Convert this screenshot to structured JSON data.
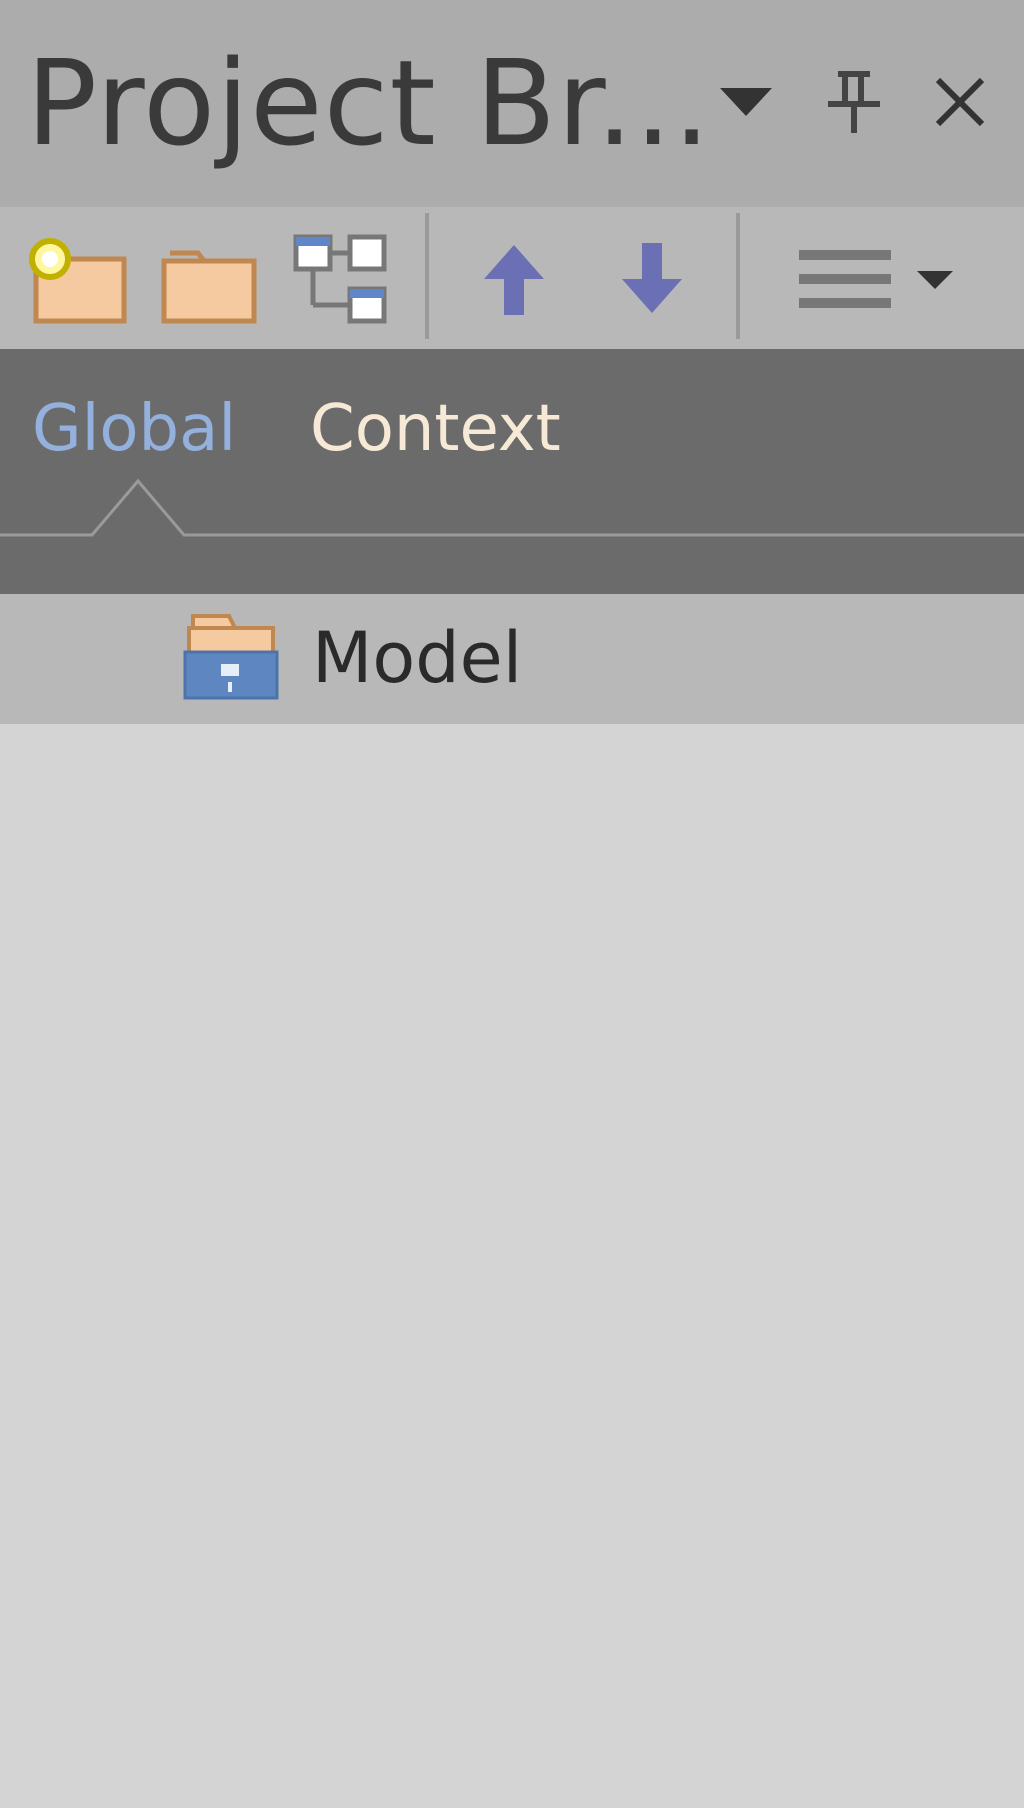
{
  "window": {
    "title": "Project Br...",
    "menu_icon": "chevron-down-icon",
    "pin_icon": "pin-icon",
    "close_icon": "close-icon"
  },
  "toolbar": {
    "buttons": [
      {
        "name": "new-package-button",
        "icon": "new-folder-icon"
      },
      {
        "name": "new-folder-button",
        "icon": "folder-icon"
      },
      {
        "name": "new-diagram-button",
        "icon": "diagram-icon"
      },
      {
        "name": "move-up-button",
        "icon": "arrow-up-icon"
      },
      {
        "name": "move-down-button",
        "icon": "arrow-down-icon"
      },
      {
        "name": "options-menu-button",
        "icon": "hamburger-menu-icon"
      }
    ]
  },
  "tabs": [
    {
      "label": "Global",
      "active": true
    },
    {
      "label": "Context",
      "active": false
    }
  ],
  "tree": {
    "items": [
      {
        "label": "Model",
        "icon": "model-root-icon"
      }
    ]
  },
  "colors": {
    "titlebar": "#acacac",
    "toolbar": "#b8b8b8",
    "tabstrip": "#6b6b6b",
    "tab_active": "#94b0dc",
    "tab_inactive": "#f6ead6",
    "tree_background": "#d4d4d4",
    "arrow": "#6b6fb4"
  }
}
